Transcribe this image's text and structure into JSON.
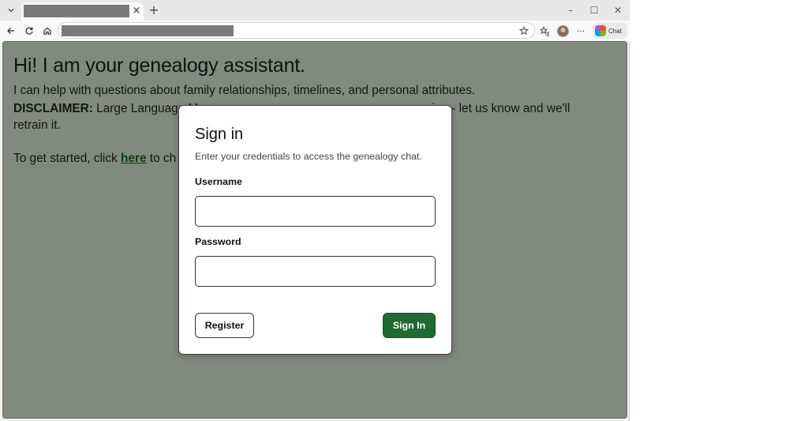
{
  "browser": {
    "new_tab_symbol": "+",
    "tab_close_symbol": "×",
    "window_controls": {
      "minimize": "–",
      "maximize": "☐",
      "close": "✕"
    },
    "more_symbol": "···",
    "chat_label": "Chat",
    "icons": [
      "tab-list-chevron-icon",
      "back-arrow-icon",
      "reload-icon",
      "home-icon",
      "favorite-star-icon",
      "favorites-icon",
      "profile-avatar-icon",
      "copilot-icon"
    ]
  },
  "page": {
    "title": "Hi! I am your genealogy assistant.",
    "intro": "I can help with questions about family relationships, timelines, and personal attributes.",
    "disclaimer_label": "DISCLAIMER:",
    "disclaimer_visible_start": " Large Language M",
    "disclaimer_visible_end": "ion - let us know and we'll",
    "disclaimer_line2": "retrain it.",
    "get_started_prefix": "To get started, click ",
    "get_started_link": "here",
    "get_started_suffix_visible": " to ch"
  },
  "modal": {
    "title": "Sign in",
    "subtitle": "Enter your credentials to access the genealogy chat.",
    "username_label": "Username",
    "username_value": "",
    "password_label": "Password",
    "password_value": "",
    "register_label": "Register",
    "signin_label": "Sign In"
  },
  "colors": {
    "overlay_background": "#818a7e",
    "primary_button": "#1f6b32",
    "link": "#0e3d16"
  }
}
